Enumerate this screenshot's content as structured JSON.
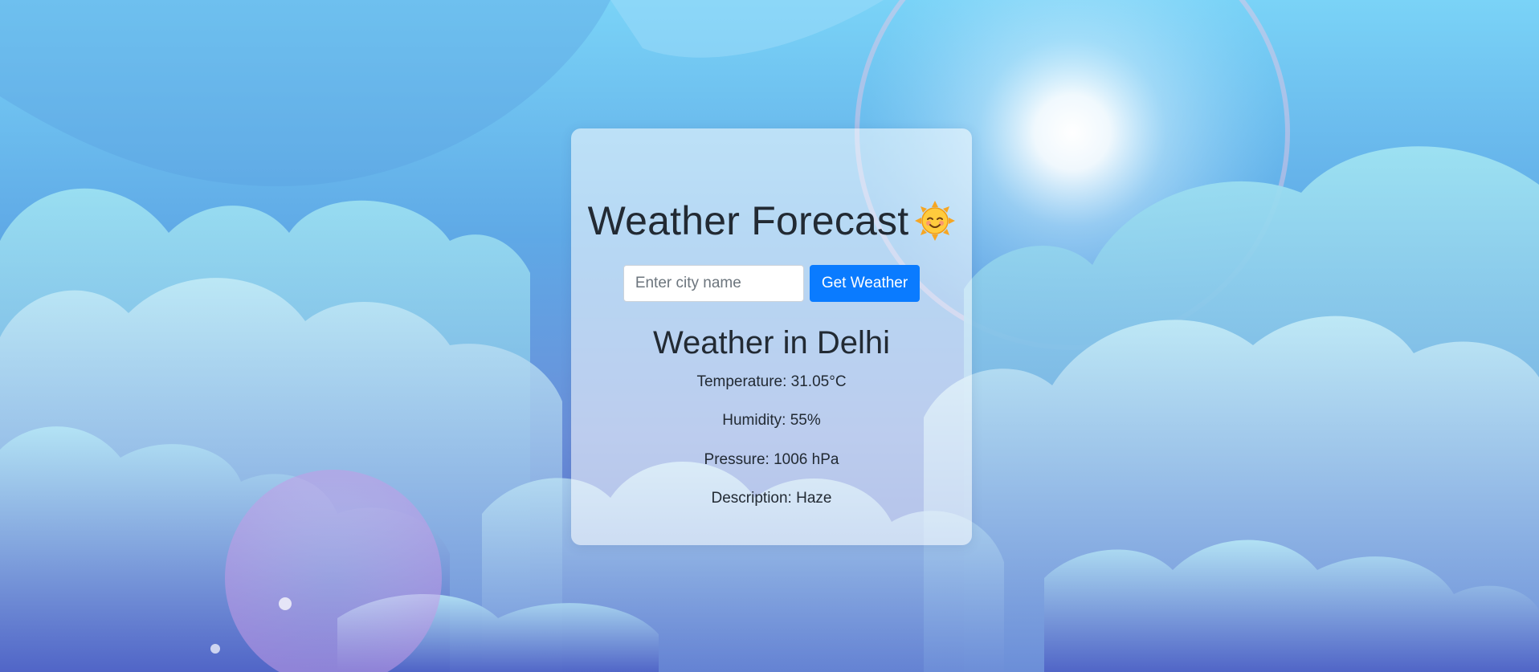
{
  "header": {
    "title": "Weather Forecast",
    "title_icon": "smiling-sun-icon"
  },
  "search": {
    "placeholder": "Enter city name",
    "value": "",
    "button_label": "Get Weather"
  },
  "result": {
    "heading": "Weather in Delhi",
    "temperature": "Temperature: 31.05°C",
    "humidity": "Humidity: 55%",
    "pressure": "Pressure: 1006 hPa",
    "description": "Description: Haze"
  },
  "colors": {
    "button": "#0a7bff",
    "text": "#222a33",
    "card": "rgba(255,255,255,0.55)"
  }
}
